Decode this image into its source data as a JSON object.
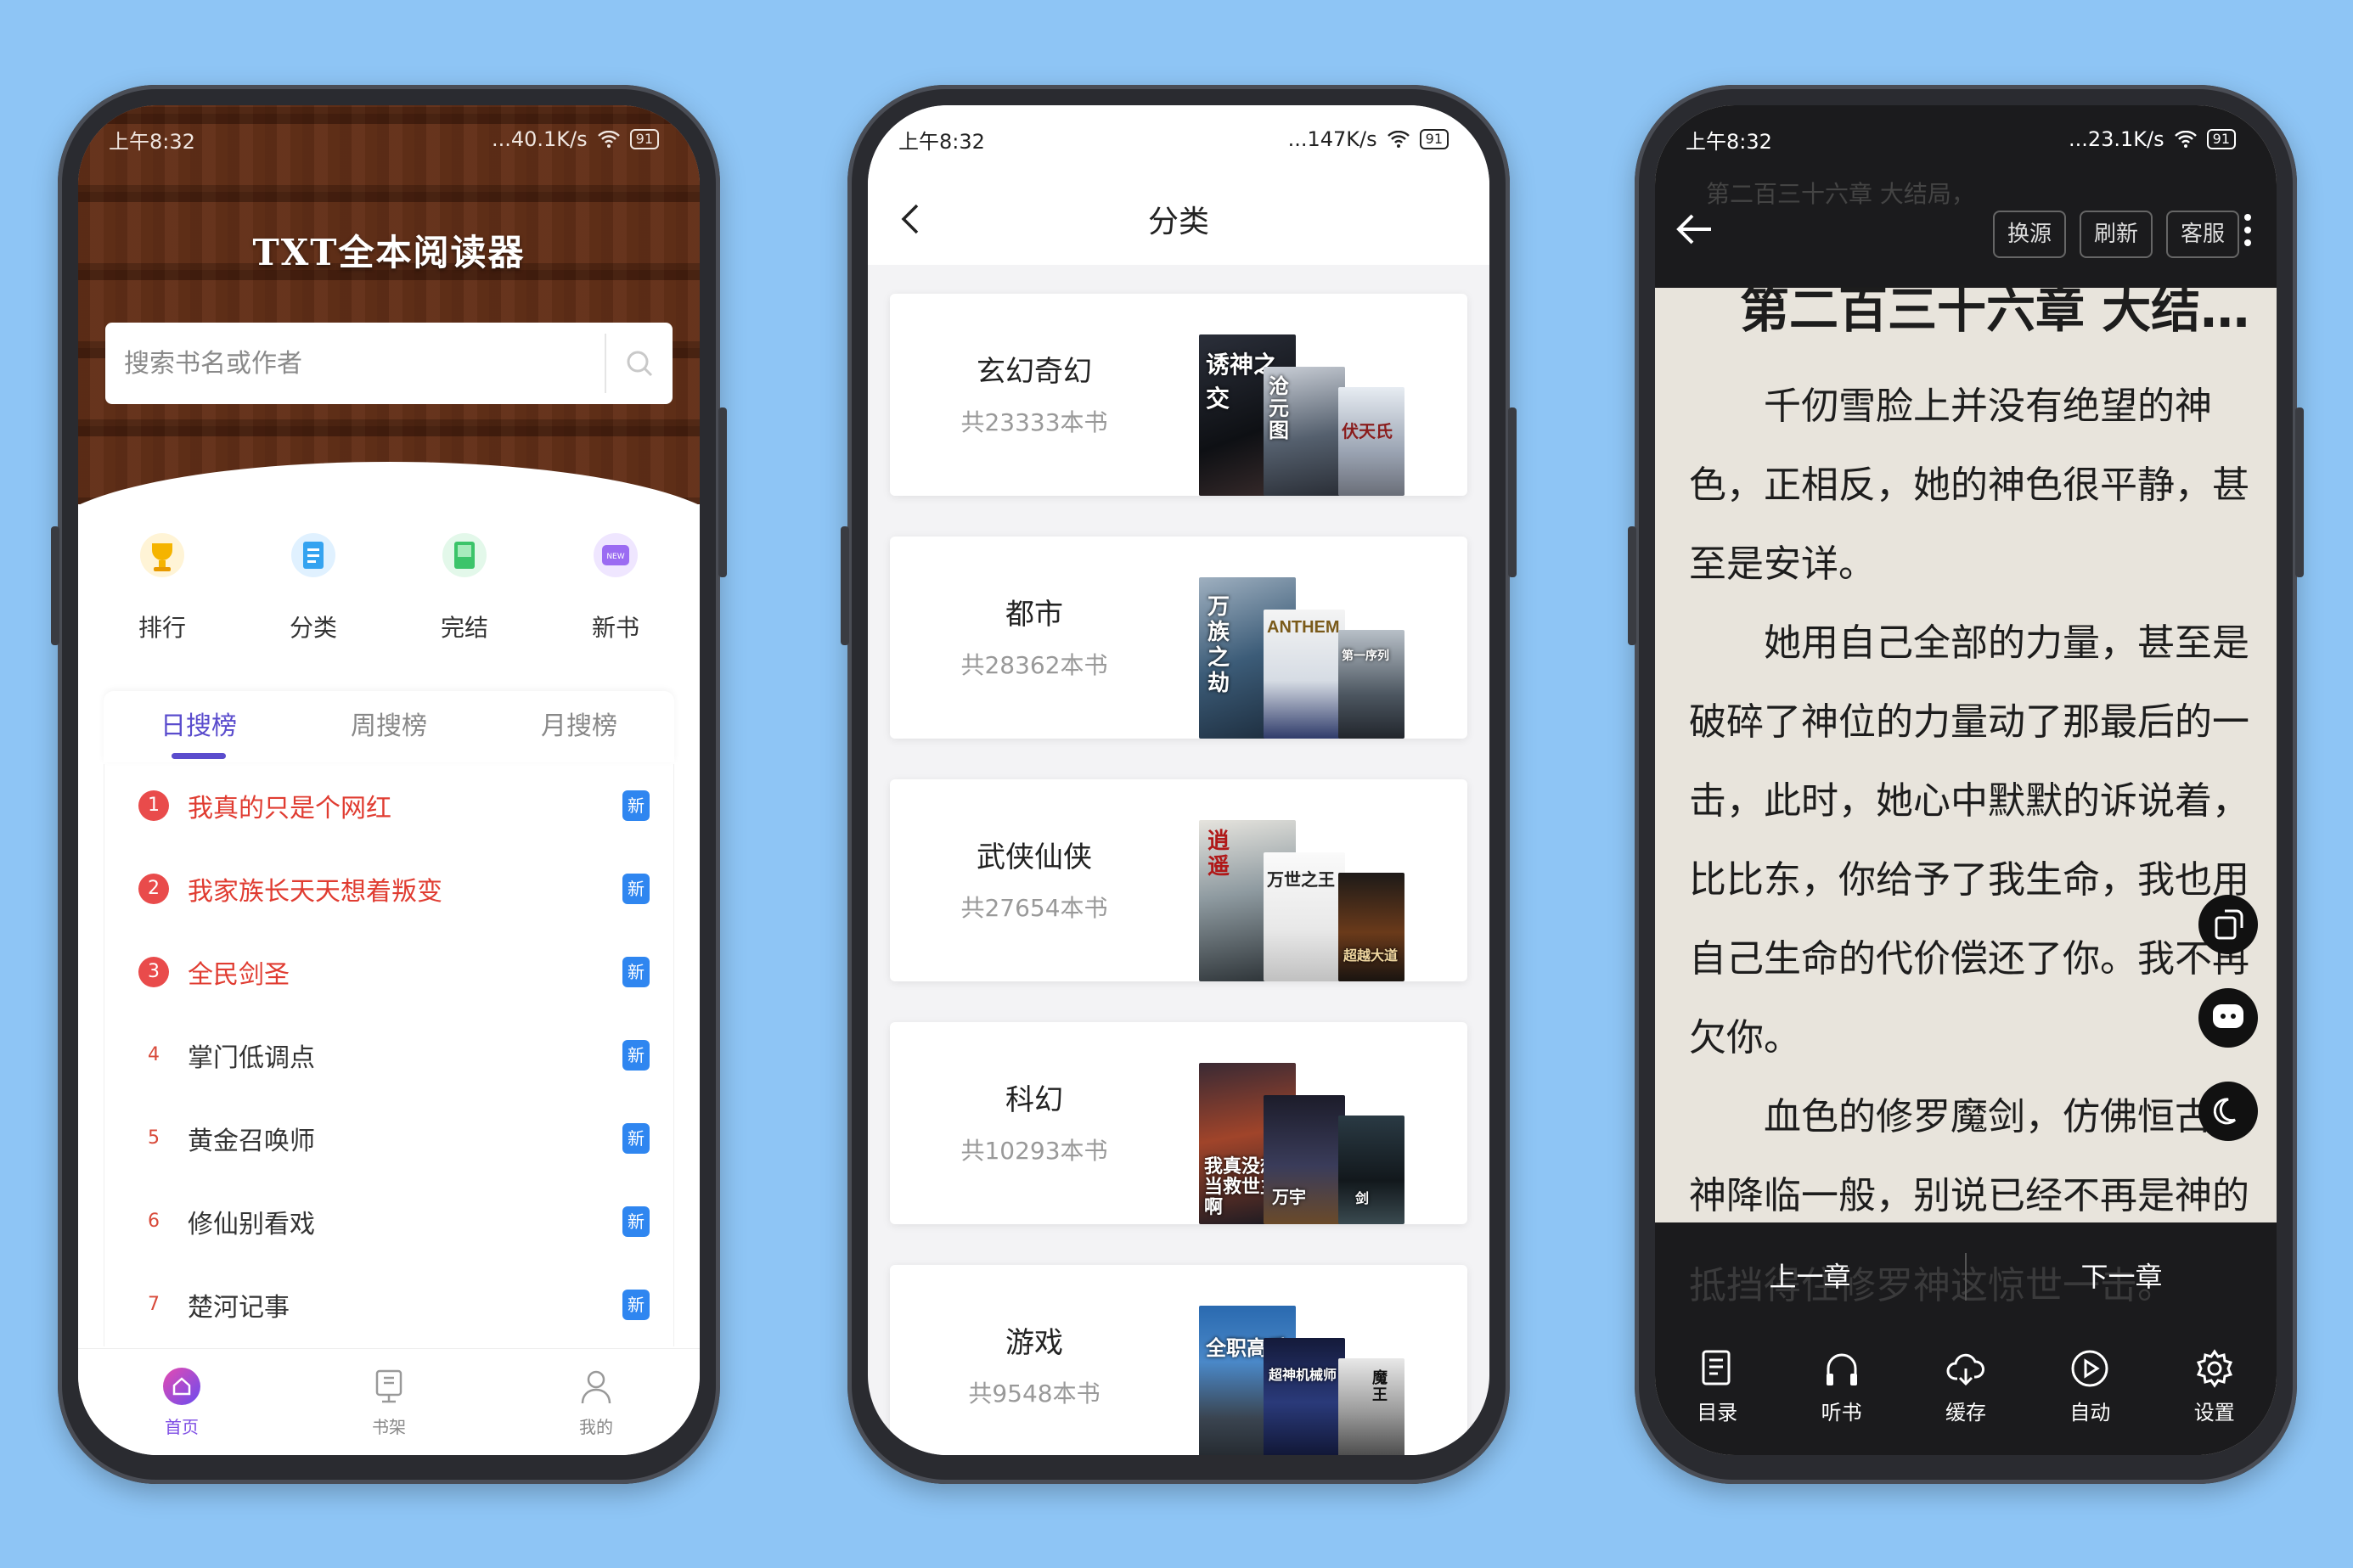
{
  "phone1": {
    "status": {
      "time": "上午8:32",
      "speed": "...40.1K/s",
      "battery": "91"
    },
    "app_title": "TXT全本阅读器",
    "search": {
      "placeholder": "搜索书名或作者"
    },
    "categories": [
      {
        "label": "排行",
        "icon": "trophy-icon",
        "color": "#f5b400"
      },
      {
        "label": "分类",
        "icon": "category-icon",
        "color": "#35a3f0"
      },
      {
        "label": "完结",
        "icon": "book-done-icon",
        "color": "#3cc46a"
      },
      {
        "label": "新书",
        "icon": "new-book-icon",
        "color": "#9b6bf2"
      }
    ],
    "tabs": [
      "日搜榜",
      "周搜榜",
      "月搜榜"
    ],
    "ranking": [
      {
        "n": "1",
        "title": "我真的只是个网红",
        "badge": "新"
      },
      {
        "n": "2",
        "title": "我家族长天天想着叛变",
        "badge": "新"
      },
      {
        "n": "3",
        "title": "全民剑圣",
        "badge": "新"
      },
      {
        "n": "4",
        "title": "掌门低调点",
        "badge": "新"
      },
      {
        "n": "5",
        "title": "黄金召唤师",
        "badge": "新"
      },
      {
        "n": "6",
        "title": "修仙别看戏",
        "badge": "新"
      },
      {
        "n": "7",
        "title": "楚河记事",
        "badge": "新"
      }
    ],
    "nav": [
      {
        "label": "首页"
      },
      {
        "label": "书架"
      },
      {
        "label": "我的"
      }
    ],
    "accent": "#7d4ce4"
  },
  "phone2": {
    "status": {
      "time": "上午8:32",
      "speed": "...147K/s",
      "battery": "91"
    },
    "title": "分类",
    "items": [
      {
        "name": "玄幻奇幻",
        "count": "共23333本书",
        "covers": [
          "诱神之交",
          "沧元图",
          "伏天氏"
        ]
      },
      {
        "name": "都市",
        "count": "共28362本书",
        "covers": [
          "万族之劫",
          "ANTHEM",
          "第一序列"
        ]
      },
      {
        "name": "武侠仙侠",
        "count": "共27654本书",
        "covers": [
          "逍遥",
          "万世之王",
          "超越大道"
        ]
      },
      {
        "name": "科幻",
        "count": "共10293本书",
        "covers": [
          "我真没想当救世主啊",
          "万宇",
          "剑"
        ]
      },
      {
        "name": "游戏",
        "count": "共9548本书",
        "covers": [
          "全职高手",
          "超神机械师",
          "魔王"
        ]
      }
    ]
  },
  "phone3": {
    "status": {
      "time": "上午8:32",
      "speed": "...23.1K/s",
      "battery": "91"
    },
    "ghost_top": "第二百三十六章 大结局，",
    "buttons": [
      "换源",
      "刷新",
      "客服"
    ],
    "chapter_title": "第二百三十六章 大结局，...",
    "paragraphs": [
      "千仞雪脸上并没有绝望的神色，正相反，她的神色很平静，甚至是安详。",
      "她用自己全部的力量，甚至是破碎了神位的力量动了那最后的一击，此时，她心中默默的诉说着，比比东，你给予了我生命，我也用自己生命的代价偿还了你。我不再欠你。",
      "血色的修罗魔剑，仿佛恒古杀神降临一般，别说已经不再是神的千仞雪，就算她还是天使之神，也不可能"
    ],
    "ghost_bottom": "抵挡得住修罗神这惊世一击。",
    "prev": "上一章",
    "next": "下一章",
    "tools": [
      {
        "label": "目录",
        "icon": "catalog-icon"
      },
      {
        "label": "听书",
        "icon": "headphones-icon"
      },
      {
        "label": "缓存",
        "icon": "cloud-download-icon"
      },
      {
        "label": "自动",
        "icon": "play-icon"
      },
      {
        "label": "设置",
        "icon": "settings-icon"
      }
    ]
  }
}
